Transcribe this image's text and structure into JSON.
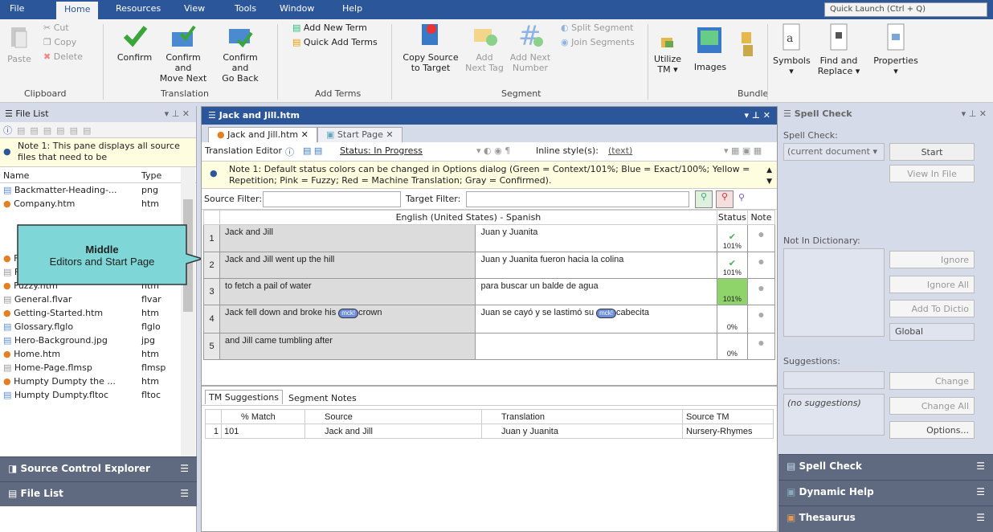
{
  "menu": {
    "file": "File",
    "home": "Home",
    "resources": "Resources",
    "view": "View",
    "tools": "Tools",
    "window": "Window",
    "help": "Help",
    "quick_launch": "Quick Launch (Ctrl + Q)"
  },
  "ribbon": {
    "paste": "Paste",
    "cut": "Cut",
    "copy": "Copy",
    "delete": "Delete",
    "clipboard": "Clipboard",
    "confirm": "Confirm",
    "confirm_move_next_1": "Confirm and",
    "confirm_move_next_2": "Move Next",
    "confirm_go_back_1": "Confirm and",
    "confirm_go_back_2": "Go Back",
    "translation": "Translation",
    "add_new_term": "Add New Term",
    "quick_add_terms": "Quick Add Terms",
    "add_terms": "Add Terms",
    "copy_source_1": "Copy Source",
    "copy_source_2": "to Target",
    "add_next_tag_1": "Add",
    "add_next_tag_2": "Next Tag",
    "add_next_number_1": "Add Next",
    "add_next_number_2": "Number",
    "split_segment": "Split Segment",
    "join_segments": "Join Segments",
    "segment": "Segment",
    "utilize_tm_1": "Utilize",
    "utilize_tm_2": "TM ▾",
    "images": "Images",
    "bundle": "Bundle",
    "symbols": "Symbols",
    "find_replace_1": "Find and",
    "find_replace_2": "Replace ▾",
    "properties": "Properties"
  },
  "file_list": {
    "title": "File List",
    "note": "Note 1: This pane displays all source files that need to be",
    "col_name": "Name",
    "col_type": "Type",
    "files": [
      {
        "name": "Backmatter-Heading-...",
        "type": "png"
      },
      {
        "name": "Company.htm",
        "type": "htm"
      },
      {
        "name": "Features.htm",
        "type": "htm"
      },
      {
        "name": "Frontmatter.flpgl",
        "type": "flpgl"
      },
      {
        "name": "Fuzzy.htm",
        "type": "htm"
      },
      {
        "name": "General.flvar",
        "type": "flvar"
      },
      {
        "name": "Getting-Started.htm",
        "type": "htm"
      },
      {
        "name": "Glossary.flglo",
        "type": "flglo"
      },
      {
        "name": "Hero-Background.jpg",
        "type": "jpg"
      },
      {
        "name": "Home.htm",
        "type": "htm"
      },
      {
        "name": "Home-Page.flmsp",
        "type": "flmsp"
      },
      {
        "name": "Humpty Dumpty the ...",
        "type": "htm"
      },
      {
        "name": "Humpty Dumpty.fltoc",
        "type": "fltoc"
      }
    ],
    "source_control": "Source Control Explorer",
    "file_list_btn": "File List"
  },
  "callout": {
    "title": "Middle",
    "subtitle": "Editors and Start Page"
  },
  "editor": {
    "window_title": "Jack and Jill.htm",
    "tab1": "Jack and Jill.htm",
    "tab2": "Start Page",
    "translation_editor": "Translation Editor",
    "status": "Status: In Progress",
    "inline_styles": "Inline style(s):",
    "inline_value": "(text)",
    "note": "Note 1: Default status colors can be changed in Options dialog (Green = Context/101%; Blue = Exact/100%; Yellow = Repetition; Pink = Fuzzy; Red = Machine Translation; Gray = Confirmed).",
    "source_filter": "Source Filter:",
    "target_filter": "Target Filter:",
    "lang_header": "English (United States) - Spanish",
    "status_header": "Status",
    "note_header": "Note",
    "segments": [
      {
        "num": "1",
        "source": "Jack and Jill",
        "target": "Juan y Juanita",
        "status": "101%"
      },
      {
        "num": "2",
        "source": "Jack and Jill went up the hill",
        "target": "Juan y Juanita fueron hacia la colina",
        "status": "101%"
      },
      {
        "num": "3",
        "source": "to fetch a pail of water",
        "target": "para buscar un balde de agua",
        "status": "101%"
      },
      {
        "num": "4",
        "source_a": "Jack fell down and broke his",
        "source_b": "crown",
        "target_a": "Juan se cayó y se lastimó su",
        "target_b": "cabecita",
        "tag": "mck!",
        "status": "0%"
      },
      {
        "num": "5",
        "source": "and Jill came tumbling after",
        "target": "",
        "status": "0%"
      }
    ],
    "tm_tab": "TM Suggestions",
    "notes_tab": "Segment Notes",
    "tm_cols": {
      "match": "% Match",
      "source": "Source",
      "translation": "Translation",
      "source_tm": "Source TM"
    },
    "tm_row": {
      "num": "1",
      "match": "101",
      "source": "Jack and Jill",
      "translation": "Juan y Juanita",
      "source_tm": "Nursery-Rhymes"
    }
  },
  "spell": {
    "title": "Spell Check",
    "spell_check_label": "Spell Check:",
    "scope": "(current document",
    "start": "Start",
    "view_in_file": "View In File",
    "not_in_dictionary": "Not In Dictionary:",
    "ignore": "Ignore",
    "ignore_all": "Ignore All",
    "add_to_dictionary": "Add To Dictio",
    "dictionary": "Global",
    "suggestions": "Suggestions:",
    "change": "Change",
    "change_all": "Change All",
    "no_suggestions": "(no suggestions)",
    "options": "Options...",
    "btn_spell": "Spell Check",
    "btn_help": "Dynamic Help",
    "btn_thesaurus": "Thesaurus"
  },
  "colors": {
    "menubar": "#2b579a",
    "confirmed_green": "#8fd46a",
    "status_100": "#4caf50"
  }
}
